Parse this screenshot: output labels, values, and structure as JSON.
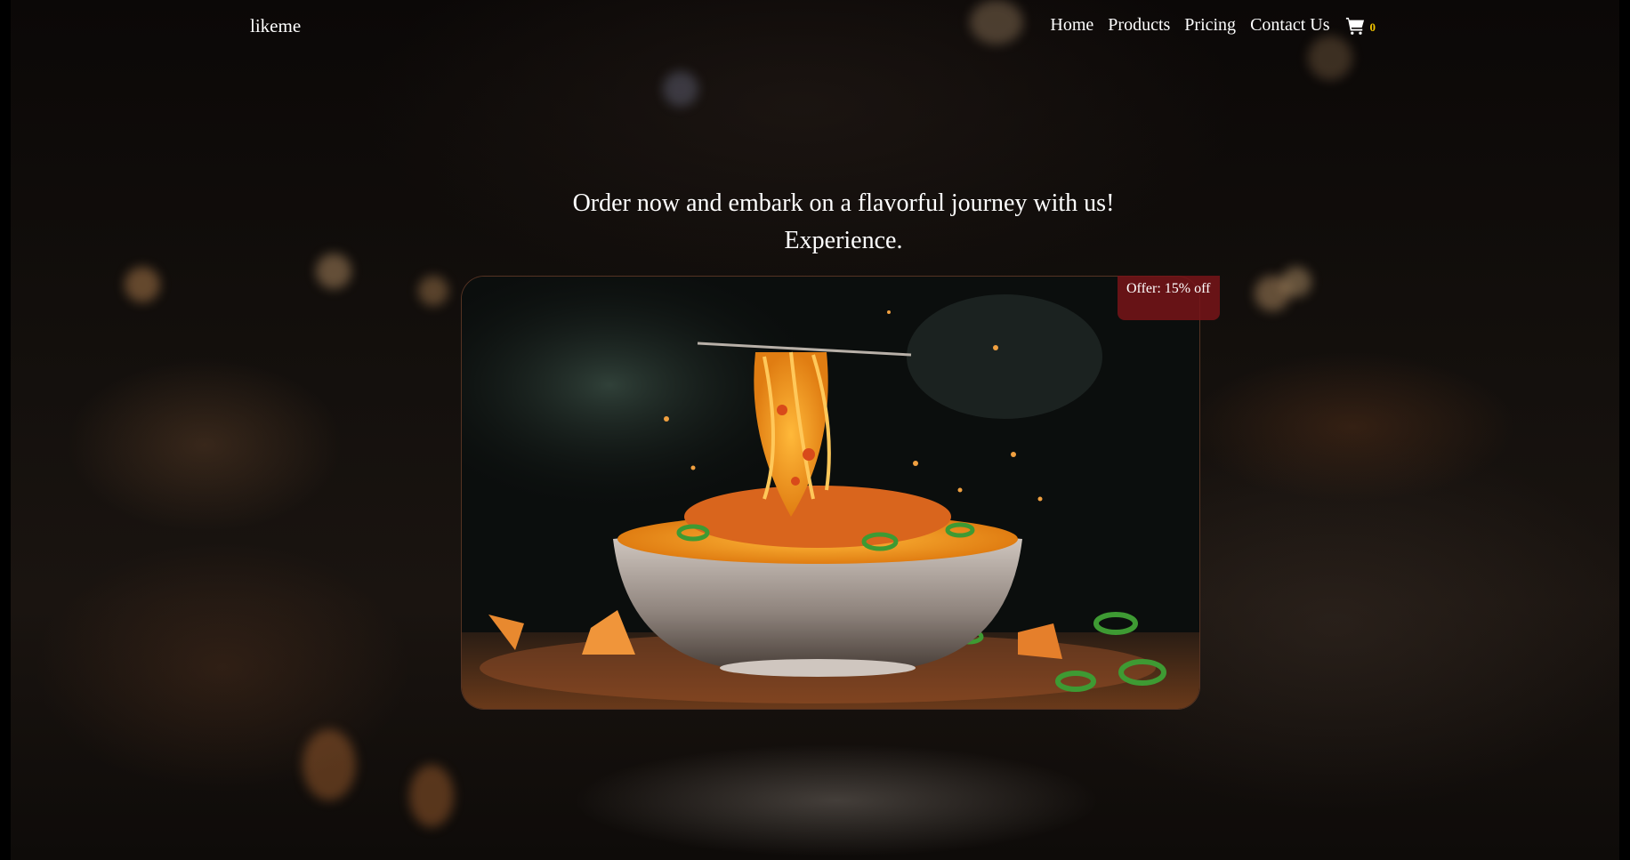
{
  "nav": {
    "logo": "likeme",
    "items": [
      {
        "label": "Home"
      },
      {
        "label": "Products"
      },
      {
        "label": "Pricing"
      },
      {
        "label": "Contact Us"
      }
    ],
    "cart_icon": "shopping-cart-icon",
    "cart_count": "0"
  },
  "hero": {
    "line1": "Order now and embark on a flavorful journey with us!",
    "line2": "Experience."
  },
  "card": {
    "offer": "Offer: 15% off"
  },
  "colors": {
    "cart_count": "#f2c400",
    "offer_bg": "#781419"
  }
}
